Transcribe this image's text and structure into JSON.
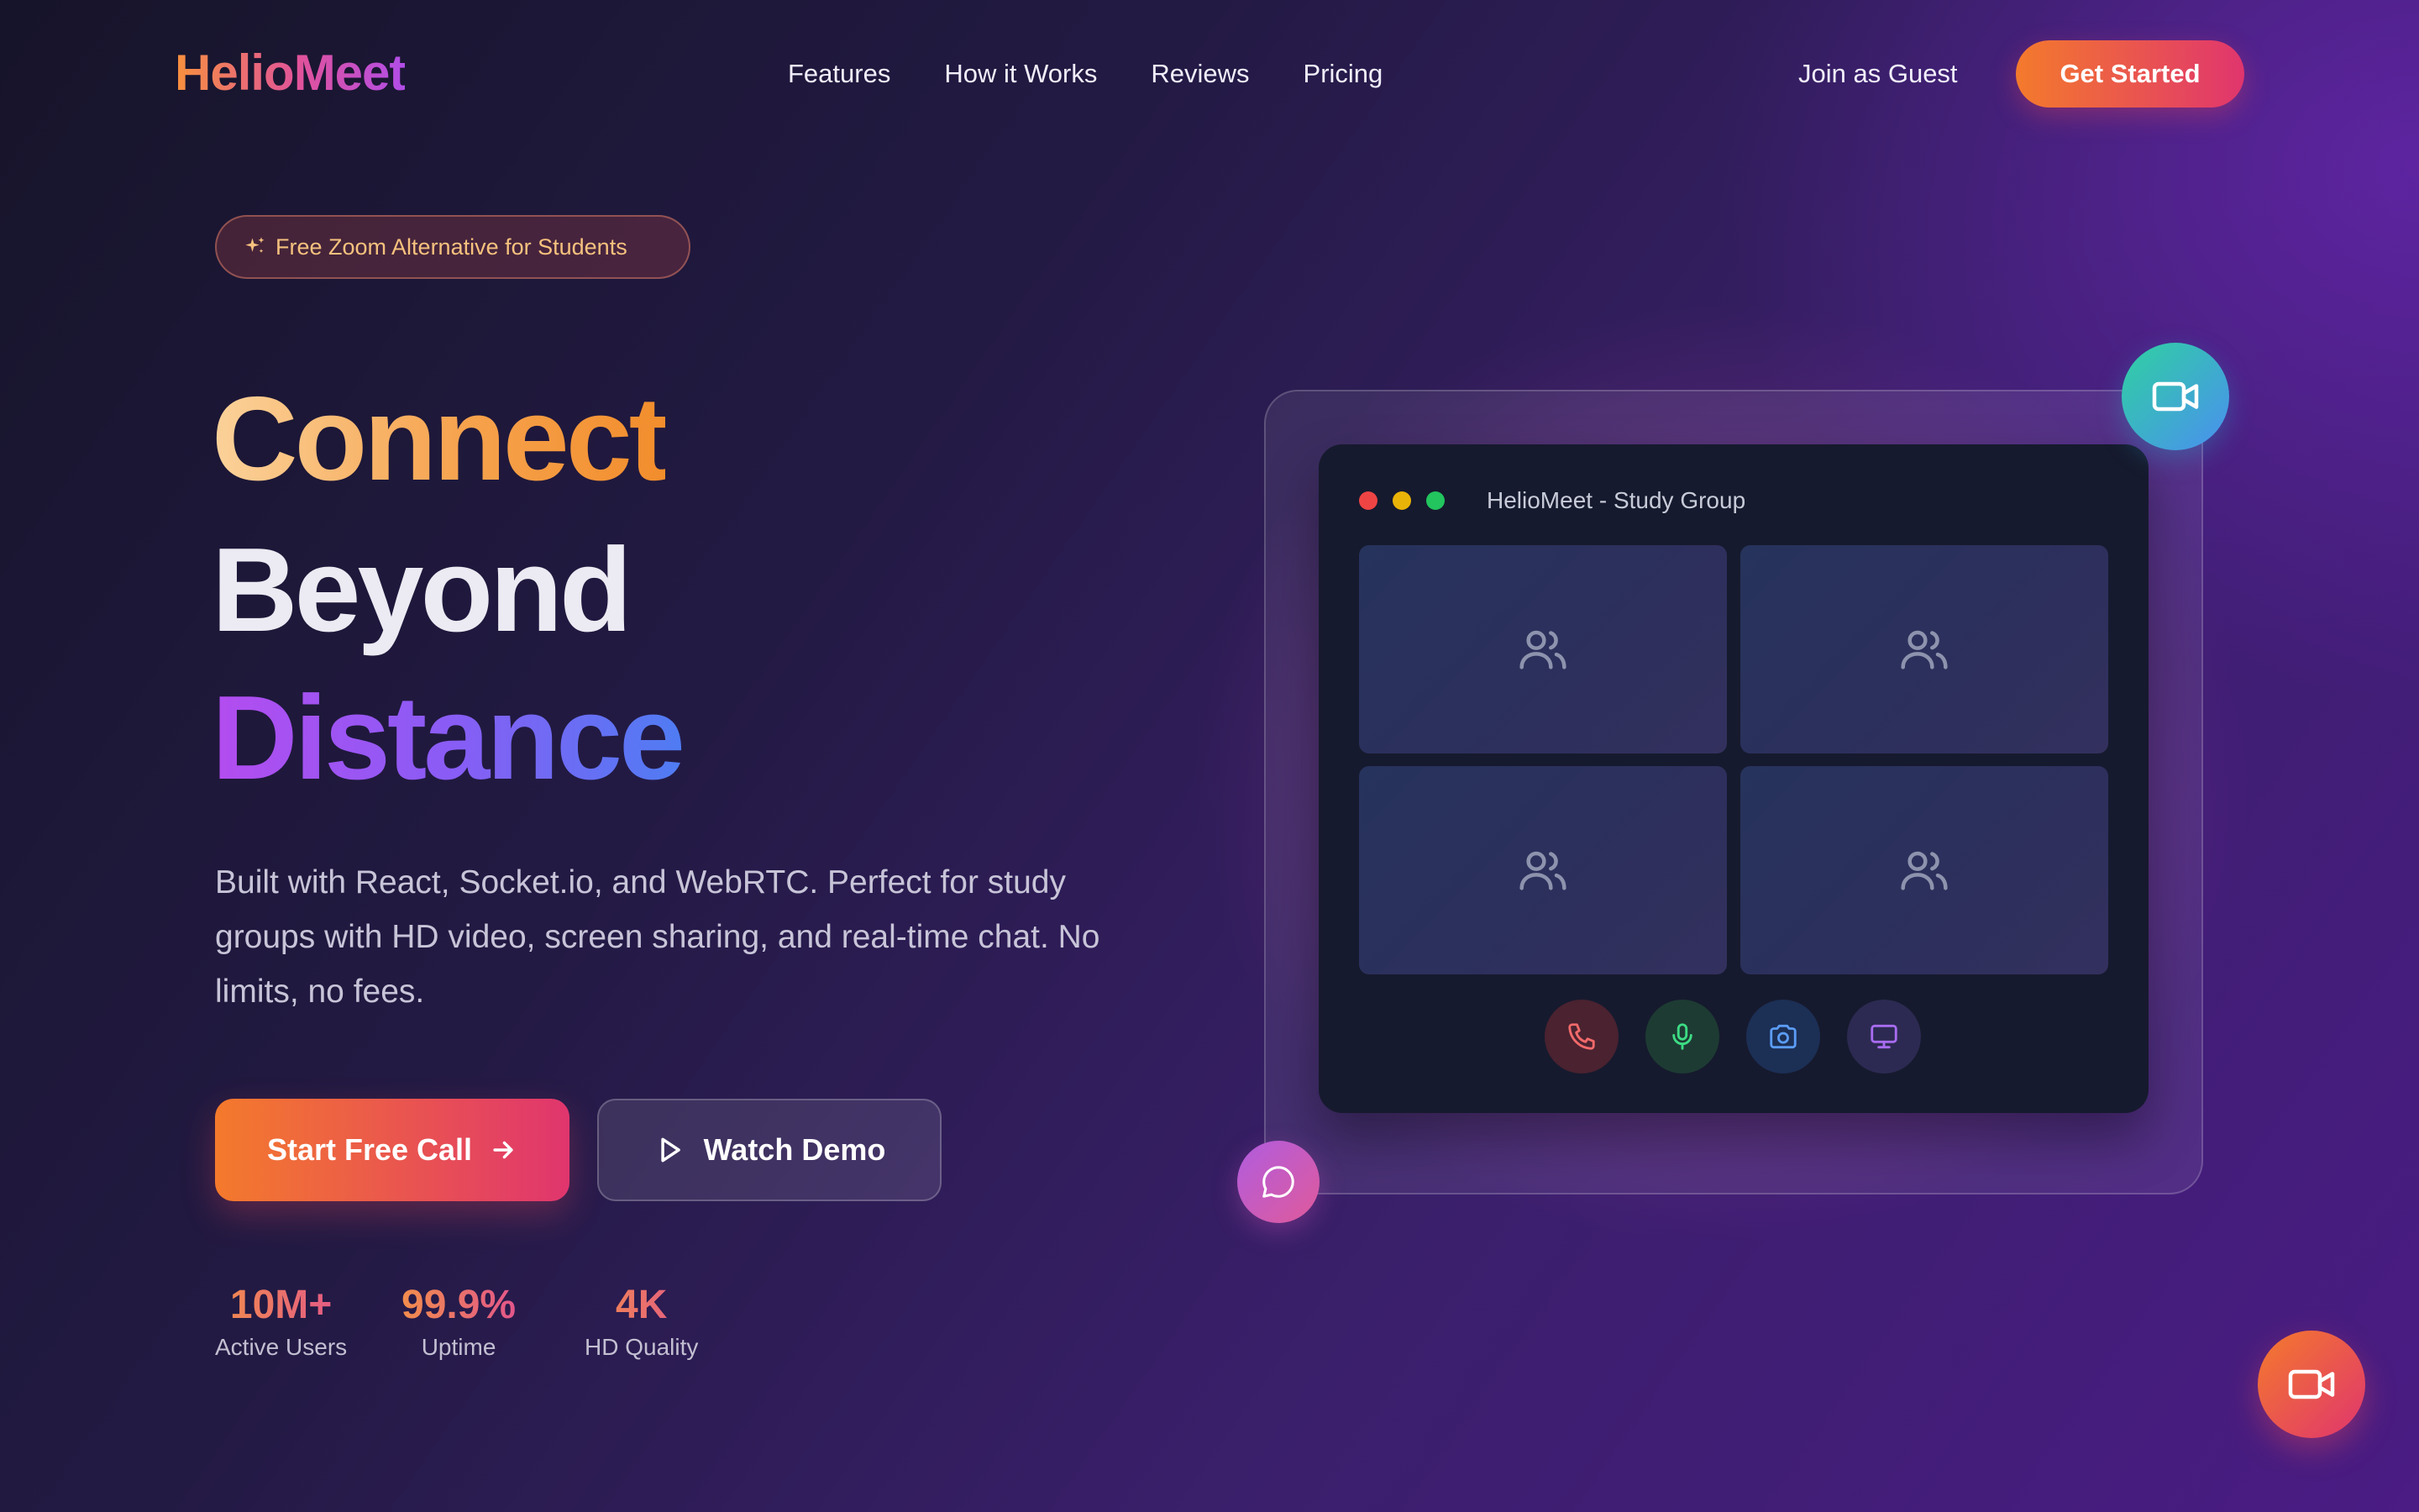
{
  "nav": {
    "logo": "HelioMeet",
    "links": [
      "Features",
      "How it Works",
      "Reviews",
      "Pricing"
    ],
    "guest_label": "Join as Guest",
    "cta_label": "Get Started"
  },
  "hero": {
    "badge_icon": "sparkles-icon",
    "badge_text": "Free Zoom Alternative for Students",
    "headline": [
      "Connect",
      "Beyond",
      "Distance"
    ],
    "description": "Built with React, Socket.io, and WebRTC. Perfect for study groups with HD video, screen sharing, and real-time chat. No limits, no fees.",
    "primary_cta": "Start Free Call",
    "secondary_cta": "Watch Demo",
    "stats": [
      {
        "value": "10M+",
        "label": "Active Users"
      },
      {
        "value": "99.9%",
        "label": "Uptime"
      },
      {
        "value": "4K",
        "label": "HD Quality"
      }
    ]
  },
  "mockup": {
    "window_title": "HelioMeet - Study Group",
    "tiles": [
      "users-icon",
      "users-icon",
      "users-icon",
      "users-icon"
    ],
    "controls": [
      "phone-icon",
      "microphone-icon",
      "camera-icon",
      "monitor-icon"
    ]
  },
  "colors": {
    "accent_orange": "#f47a2c",
    "accent_pink": "#e0356e",
    "accent_purple": "#b14de8",
    "accent_blue": "#4f7cf3",
    "window_bg": "#161a2e"
  }
}
